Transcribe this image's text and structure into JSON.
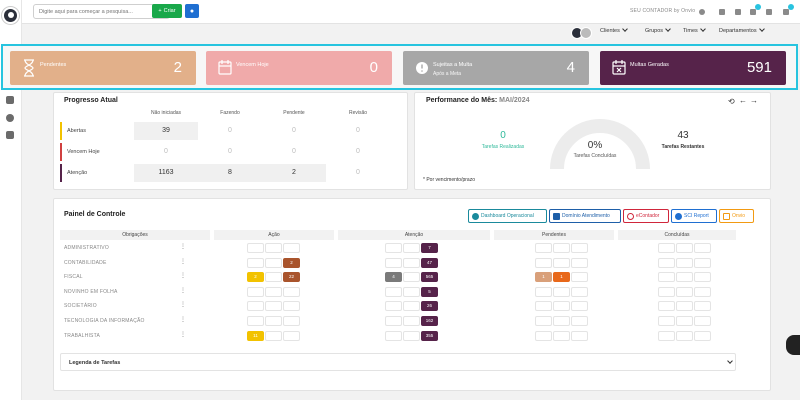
{
  "topbar": {
    "search_placeholder": "Digite aqui para começar a pesquisa...",
    "create_label": "Criar",
    "brand": "SEU CONTADOR by Onvio"
  },
  "filters": [
    "Clientes",
    "Grupos",
    "Times",
    "Departamentos"
  ],
  "cards": [
    {
      "label": "Pendentes",
      "sub": "",
      "value": "2",
      "color": "#e2b08a",
      "icon": "hourglass-icon"
    },
    {
      "label": "Vencem Hoje",
      "sub": "",
      "value": "0",
      "color": "#f0aaaa",
      "icon": "calendar-icon"
    },
    {
      "label": "Sujeitas a Multa",
      "sub": "Após a Meta",
      "value": "4",
      "color": "#a7a7a7",
      "icon": "alert-icon"
    },
    {
      "label": "Multas Geradas",
      "sub": "",
      "value": "591",
      "color": "#56234a",
      "icon": "calendar-x-icon"
    }
  ],
  "progresso": {
    "title": "Progresso Atual",
    "columns": [
      "Não iniciadas",
      "Fazendo",
      "Pendente",
      "Revisão"
    ],
    "rows": [
      {
        "label": "Abertas",
        "color": "#f2c200",
        "values": [
          "39",
          "0",
          "0",
          "0"
        ]
      },
      {
        "label": "Vencem Hoje",
        "color": "#d04040",
        "values": [
          "0",
          "0",
          "0",
          "0"
        ]
      },
      {
        "label": "Atenção",
        "color": "#56234a",
        "values": [
          "1163",
          "8",
          "2",
          "0"
        ]
      }
    ]
  },
  "performance": {
    "title": "Performance do Mês:",
    "month": "MAI/2024",
    "realizadas_value": "0",
    "realizadas_label": "Tarefas Realizadas",
    "concluidas_value": "0%",
    "concluidas_label": "Tarefas Concluídas",
    "restantes_value": "43",
    "restantes_label": "Tarefas Restantes",
    "footnote": "* Por vencimento/prazo"
  },
  "painel": {
    "title": "Painel de Controle",
    "buttons": [
      {
        "label": "Dashboard Operacional",
        "color": "#1a8a9c"
      },
      {
        "label": "Domínio Atendimento",
        "color": "#1e5fa8"
      },
      {
        "label": "eContador",
        "color": "#d0263b"
      },
      {
        "label": "SCI Report",
        "color": "#1f6fd1"
      },
      {
        "label": "Onvio",
        "color": "#f29a12"
      }
    ],
    "headers": [
      "Obrigações",
      "Ação",
      "Atenção",
      "Pendentes",
      "Concluídas"
    ],
    "rows": [
      {
        "label": "ADMINISTRATIVO",
        "acao": [
          "",
          "",
          ""
        ],
        "atencao": [
          "",
          "",
          "7"
        ],
        "pend": [
          "",
          "",
          ""
        ]
      },
      {
        "label": "CONTABILIDADE",
        "acao": [
          "",
          "",
          "2"
        ],
        "atencao": [
          "",
          "",
          "47"
        ],
        "pend": [
          "",
          "",
          ""
        ]
      },
      {
        "label": "FISCAL",
        "acao": [
          "2",
          "",
          "22"
        ],
        "atencao": [
          "4",
          "",
          "565"
        ],
        "pend": [
          "1",
          "1",
          ""
        ]
      },
      {
        "label": "NOVINHO EM FOLHA",
        "acao": [
          "",
          "",
          ""
        ],
        "atencao": [
          "",
          "",
          "5"
        ],
        "pend": [
          "",
          "",
          ""
        ]
      },
      {
        "label": "SOCIETÁRIO",
        "acao": [
          "",
          "",
          ""
        ],
        "atencao": [
          "",
          "",
          "26"
        ],
        "pend": [
          "",
          "",
          ""
        ]
      },
      {
        "label": "TECNOLOGIA DA INFORMAÇÃO",
        "acao": [
          "",
          "",
          ""
        ],
        "atencao": [
          "",
          "",
          "162"
        ],
        "pend": [
          "",
          "",
          ""
        ]
      },
      {
        "label": "TRABALHISTA",
        "acao": [
          "11",
          "",
          ""
        ],
        "atencao": [
          "",
          "",
          "355"
        ],
        "pend": [
          "",
          "",
          ""
        ]
      }
    ],
    "legend_label": "Legenda de Tarefas"
  }
}
